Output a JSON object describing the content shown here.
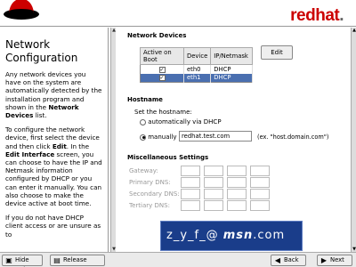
{
  "header": {
    "brand_main": "redhat",
    "brand_dot": ".",
    "brand_color": "#cc0000"
  },
  "help": {
    "title": "Network Configuration",
    "p1": "Any network devices you have on the system are automatically detected by the installation program and shown in the",
    "p1_bold": "Network Devices",
    "p1_end": "list.",
    "p2_a": "To configure the network device, first select the device and then click",
    "p2_edit": "Edit",
    "p2_b": ". In the",
    "p2_edit_iface": "Edit Interface",
    "p2_c": "screen, you can choose to have the IP and Netmask information configured by DHCP or you can enter it manually. You can also choose to make the device active at boot time.",
    "p3": "If you do not have DHCP client access or are unsure as to"
  },
  "network_devices": {
    "label": "Network Devices",
    "columns": [
      "Active on Boot",
      "Device",
      "IP/Netmask"
    ],
    "rows": [
      {
        "active": "✓",
        "device": "eth0",
        "ip": "DHCP",
        "selected": false
      },
      {
        "active": "✓",
        "device": "eth1",
        "ip": "DHCP",
        "selected": true
      }
    ],
    "edit_label": "Edit"
  },
  "hostname": {
    "label": "Hostname",
    "set_label": "Set the hostname:",
    "auto_label": "automatically via DHCP",
    "manual_label": "manually",
    "manual_value": "redhat.test.com",
    "example": "(ex. \"host.domain.com\")"
  },
  "misc": {
    "label": "Miscellaneous Settings",
    "gateway": "Gateway:",
    "primary_dns": "Primary DNS:",
    "secondary_dns": "Secondary DNS:",
    "tertiary_dns": "Tertiary DNS:"
  },
  "bottom": {
    "hide_help": "Hide Help",
    "release_notes": "Release Notes",
    "back": "Back",
    "next": "Next"
  },
  "watermark": {
    "prefix": "z_y_f_@",
    "brand": "msn",
    "suffix": ".com"
  },
  "icons": {
    "hide_help": "help-icon",
    "release_notes": "notes-icon",
    "back": "back-arrow-icon",
    "next": "next-arrow-icon"
  }
}
